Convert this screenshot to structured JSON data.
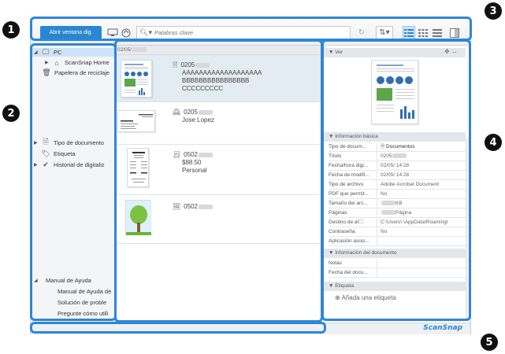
{
  "callouts": [
    "1",
    "2",
    "3",
    "4",
    "5"
  ],
  "toolbar": {
    "open_button": "Abrir ventana dig.",
    "search_placeholder": "Palabras clave"
  },
  "sidebar": {
    "pc": "PC",
    "scansnap_home": "ScanSnap Home",
    "trash": "Papelera de reciclaje",
    "doc_type": "Tipo de documento",
    "label": "Etiqueta",
    "history": "Historial de digitaliz",
    "help": "Manual de Ayuda",
    "help_items": [
      "Manual de Ayuda de",
      "Solución de proble",
      "Pregunte cómo utili"
    ]
  },
  "list": {
    "date_header": "02/05/",
    "rows": [
      {
        "title": "0205",
        "lines": [
          "AAAAAAAAAAAAAAAAAAA",
          "BBBBBBBBBBBBBBBB",
          "CCCCCCCCC"
        ]
      },
      {
        "title": "0205",
        "lines": [
          "Jose Lopez"
        ]
      },
      {
        "title": "0502",
        "lines": [
          "$88.50",
          "Personal"
        ]
      },
      {
        "title": "0502",
        "lines": []
      }
    ]
  },
  "details": {
    "view_header": "Ver",
    "basic_header": "Información básica",
    "basic": [
      {
        "k": "Tipo de docum...",
        "v": "Documentos"
      },
      {
        "k": "Título",
        "v": "0205"
      },
      {
        "k": "Fecha/hora digi...",
        "v": "02/05/      14:28"
      },
      {
        "k": "Fecha de modifi...",
        "v": "02/05/      14:28"
      },
      {
        "k": "Tipo de archivo",
        "v": "Adobe Acrobat Document"
      },
      {
        "k": "PDF que permit...",
        "v": "No"
      },
      {
        "k": "Tamaño del arc...",
        "v": "KB"
      },
      {
        "k": "Páginas",
        "v": "Página"
      },
      {
        "k": "Destino de al",
        "v": "C:\\Users\\     \\AppData\\Roaming\\"
      },
      {
        "k": "Contraseña",
        "v": "No"
      },
      {
        "k": "Aplicación asoci...",
        "v": ""
      }
    ],
    "doc_header": "Información del documento",
    "doc": [
      {
        "k": "Notas",
        "v": ""
      },
      {
        "k": "Fecha del docu...",
        "v": ""
      }
    ],
    "label_header": "Etiqueta",
    "add_label": "Añada una etiqueta"
  },
  "brand": "ScanSnap",
  "colors": {
    "accent": "#2a86d1",
    "highlight": "#2f86d6",
    "selected": "#cfe3f6"
  }
}
